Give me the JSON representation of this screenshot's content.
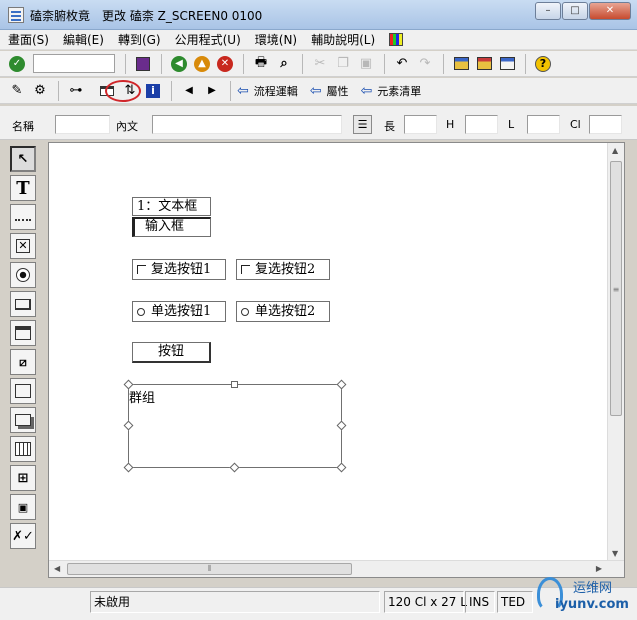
{
  "window": {
    "title": "磕柰腑枚竟　更改 磕柰 Z_SCREEN0 0100",
    "minimize": "–",
    "maximize": "□",
    "close": "✕"
  },
  "menu": [
    "畫面(S)",
    "編輯(E)",
    "轉到(G)",
    "公用程式(U)",
    "環境(N)",
    "輔助說明(L)"
  ],
  "toolbar2": {
    "flow_logic": "流程運輯",
    "attributes": "屬性",
    "element_list": "元素清單"
  },
  "properties": {
    "name_label": "名稱",
    "text_label": "內文",
    "length_label": "長",
    "height_label": "H",
    "line_label": "L",
    "column_label": "Cl"
  },
  "canvas": {
    "textbox": "1：文本框",
    "inputbox": "输入框",
    "checkbox1": "复选按钮1",
    "checkbox2": "复选按钮2",
    "radio1": "单选按钮1",
    "radio2": "单选按钮2",
    "button": "按钮",
    "group": "群组"
  },
  "status": {
    "mode": "未啟用",
    "size": "120 Cl x 27 L",
    "ins": "INS",
    "ted": "TED"
  },
  "watermark": {
    "cn": "运维网",
    "en": "iyunv.com"
  },
  "colors": {
    "highlight_ring": "#d0262a",
    "link_arrow": "#1b4fb0"
  }
}
